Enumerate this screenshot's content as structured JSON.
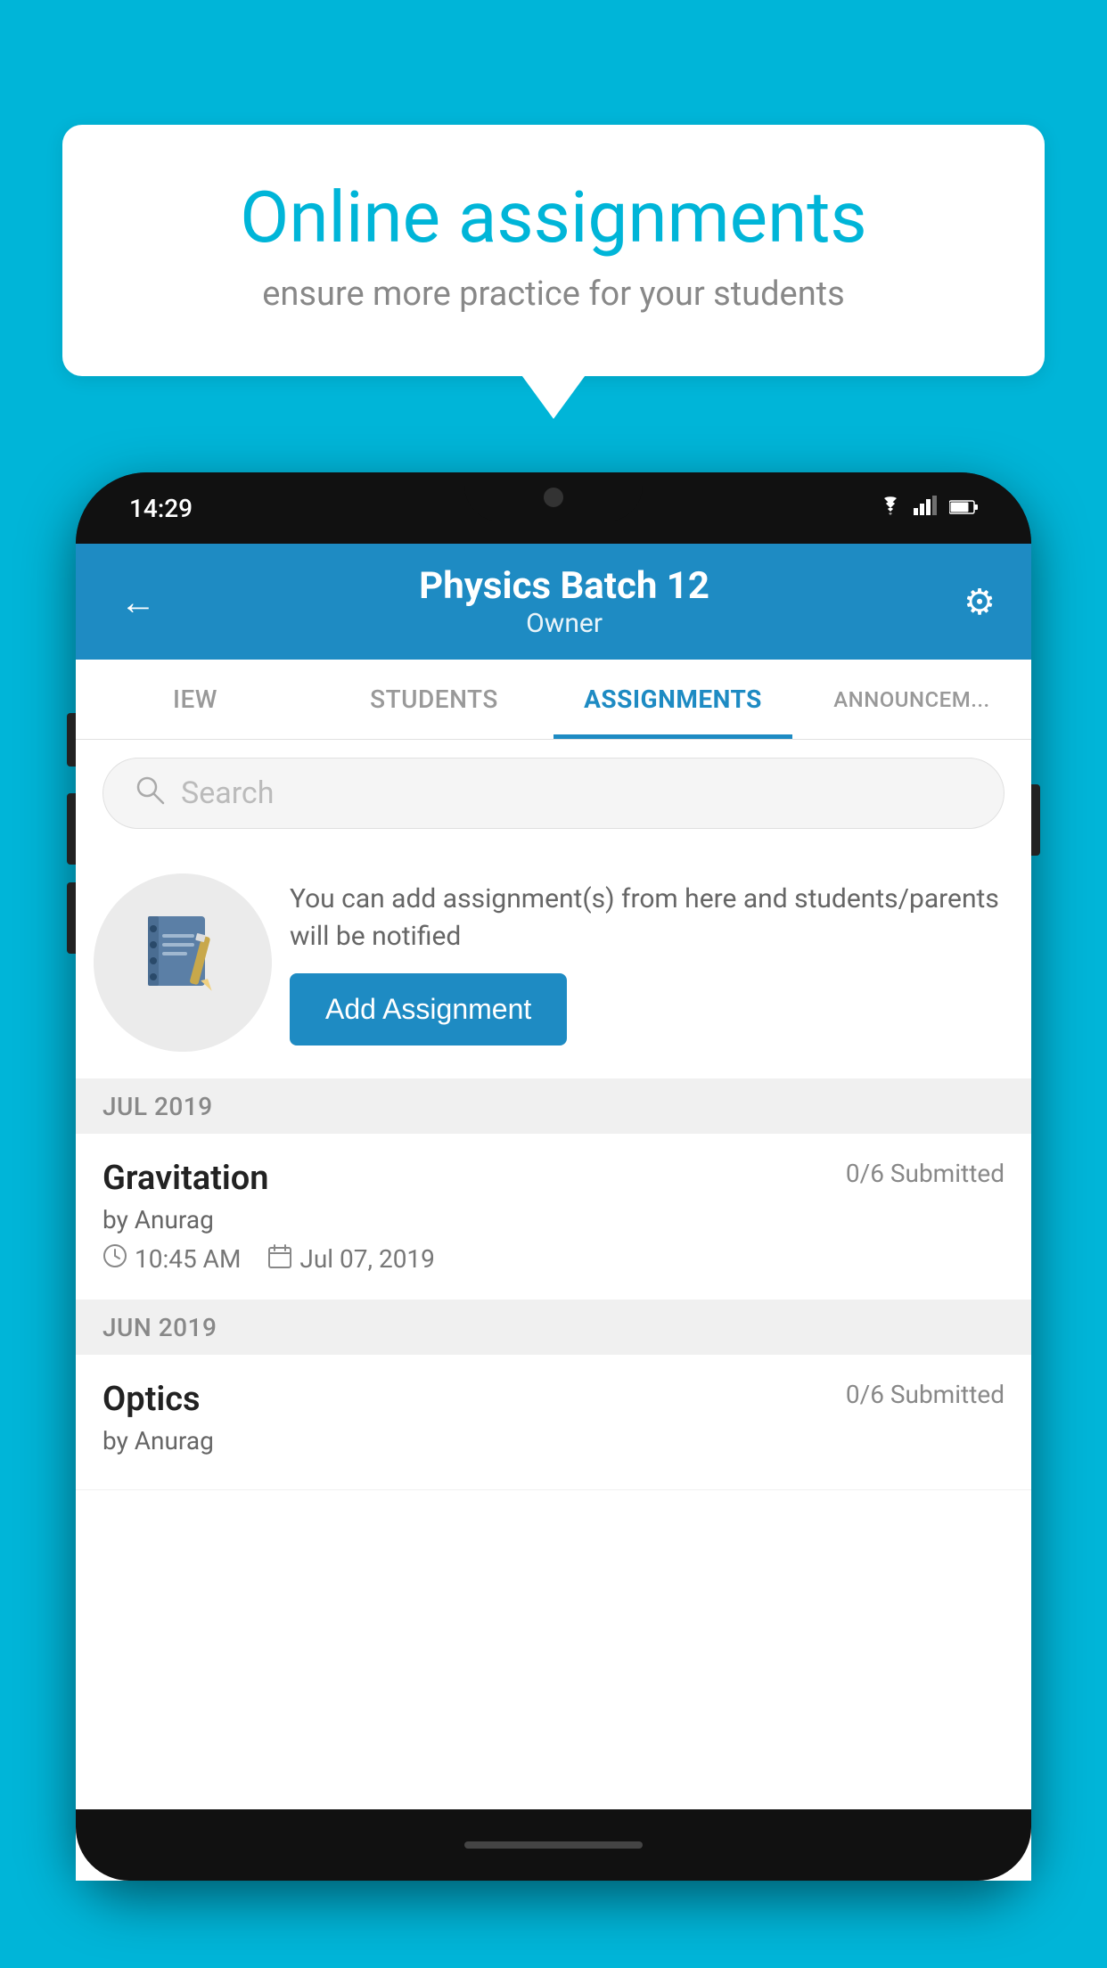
{
  "background": {
    "color": "#00B5D8"
  },
  "speech_bubble": {
    "title": "Online assignments",
    "subtitle": "ensure more practice for your students"
  },
  "phone": {
    "status_bar": {
      "time": "14:29",
      "wifi": "wifi",
      "signal": "signal",
      "battery": "battery"
    },
    "app_bar": {
      "title": "Physics Batch 12",
      "subtitle": "Owner",
      "back_label": "←",
      "settings_label": "⚙"
    },
    "tabs": [
      {
        "label": "IEW",
        "active": false
      },
      {
        "label": "STUDENTS",
        "active": false
      },
      {
        "label": "ASSIGNMENTS",
        "active": true
      },
      {
        "label": "ANNOUNCEM...",
        "active": false
      }
    ],
    "search": {
      "placeholder": "Search"
    },
    "promo": {
      "description": "You can add assignment(s) from here and students/parents will be notified",
      "add_button_label": "Add Assignment"
    },
    "sections": [
      {
        "header": "JUL 2019",
        "assignments": [
          {
            "name": "Gravitation",
            "submitted": "0/6 Submitted",
            "author": "by Anurag",
            "time": "10:45 AM",
            "date": "Jul 07, 2019"
          }
        ]
      },
      {
        "header": "JUN 2019",
        "assignments": [
          {
            "name": "Optics",
            "submitted": "0/6 Submitted",
            "author": "by Anurag",
            "time": "",
            "date": ""
          }
        ]
      }
    ]
  }
}
